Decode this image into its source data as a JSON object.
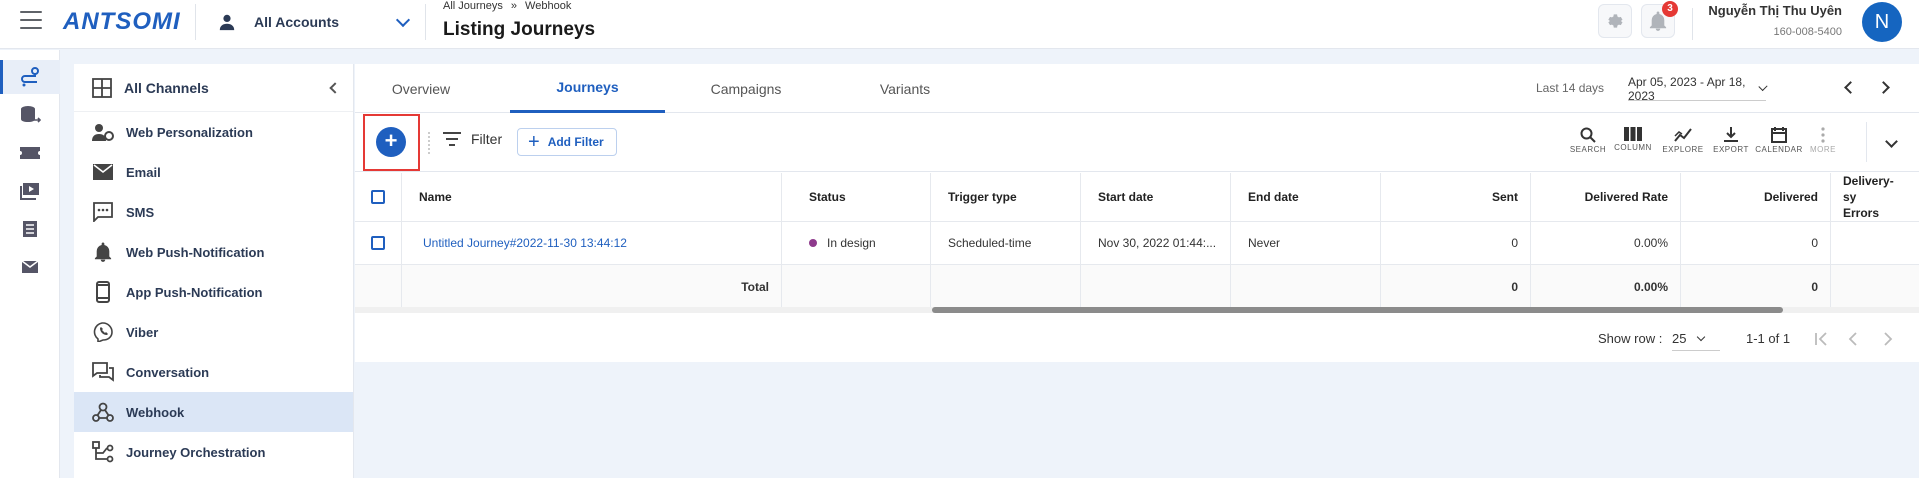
{
  "header": {
    "logo": "ANTSOMI",
    "account_label": "All Accounts",
    "breadcrumb": [
      "All Journeys",
      "»",
      "Webhook"
    ],
    "title": "Listing Journeys",
    "notification_count": "3",
    "user_name": "Nguyễn Thị Thu Uyên",
    "user_phone": "160-008-5400",
    "avatar_letter": "N"
  },
  "channels": {
    "title": "All Channels",
    "items": [
      {
        "label": "Web Personalization",
        "icon": "web-personalization-icon"
      },
      {
        "label": "Email",
        "icon": "email-icon"
      },
      {
        "label": "SMS",
        "icon": "sms-icon"
      },
      {
        "label": "Web Push-Notification",
        "icon": "bell-icon"
      },
      {
        "label": "App Push-Notification",
        "icon": "smartphone-icon"
      },
      {
        "label": "Viber",
        "icon": "viber-icon"
      },
      {
        "label": "Conversation",
        "icon": "conversation-icon"
      },
      {
        "label": "Webhook",
        "icon": "webhook-icon",
        "active": true
      },
      {
        "label": "Journey Orchestration",
        "icon": "orchestration-icon"
      }
    ]
  },
  "tabs": [
    {
      "label": "Overview"
    },
    {
      "label": "Journeys",
      "active": true
    },
    {
      "label": "Campaigns"
    },
    {
      "label": "Variants"
    }
  ],
  "date_range": {
    "label": "Last 14 days",
    "value": "Apr 05, 2023 - Apr 18, 2023"
  },
  "toolbar": {
    "filter_label": "Filter",
    "add_filter_label": "Add Filter",
    "tools": [
      {
        "label": "SEARCH",
        "icon": "search-icon"
      },
      {
        "label": "COLUMN",
        "icon": "column-icon"
      },
      {
        "label": "EXPLORE",
        "icon": "explore-icon"
      },
      {
        "label": "EXPORT",
        "icon": "export-icon"
      },
      {
        "label": "CALENDAR",
        "icon": "calendar-icon"
      },
      {
        "label": "MORE",
        "icon": "more-icon",
        "disabled": true
      }
    ]
  },
  "table": {
    "columns": [
      "Name",
      "Status",
      "Trigger type",
      "Start date",
      "End date",
      "Sent",
      "Delivered Rate",
      "Delivered",
      "Delivery-sy Errors"
    ],
    "rows": [
      {
        "name": "Untitled Journey#2022-11-30 13:44:12",
        "status": "In design",
        "trigger_type": "Scheduled-time",
        "start_date": "Nov 30, 2022 01:44:...",
        "end_date": "Never",
        "sent": "0",
        "delivered_rate": "0.00%",
        "delivered": "0"
      }
    ],
    "total": {
      "label": "Total",
      "sent": "0",
      "delivered_rate": "0.00%",
      "delivered": "0"
    }
  },
  "pagination": {
    "show_row_label": "Show row :",
    "rows_per_page": "25",
    "range": "1-1 of 1"
  },
  "colors": {
    "brand": "#1f5fbf",
    "accent_red": "#e53935",
    "status_in_design": "#8e3a8c"
  }
}
